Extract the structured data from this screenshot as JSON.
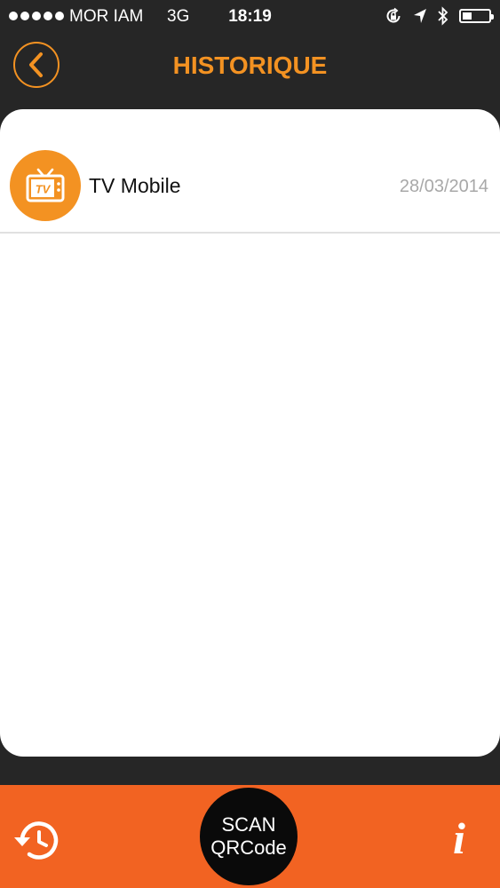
{
  "status_bar": {
    "carrier": "MOR IAM",
    "network": "3G",
    "time": "18:19",
    "battery_level": 0.35,
    "icons": [
      "orientation-lock-icon",
      "location-arrow-icon",
      "bluetooth-icon",
      "battery-icon"
    ]
  },
  "header": {
    "title": "HISTORIQUE",
    "back_icon": "chevron-left-icon"
  },
  "history": {
    "items": [
      {
        "icon": "tv-icon",
        "icon_text": "TV",
        "label": "TV Mobile",
        "date": "28/03/2014"
      }
    ]
  },
  "tabbar": {
    "history_icon": "history-clock-icon",
    "scan_line1": "SCAN",
    "scan_line2": "QRCode",
    "info_label": "i"
  },
  "colors": {
    "accent": "#f39222",
    "tabbar": "#f26322",
    "background": "#262626",
    "card": "#ffffff",
    "date_text": "#a8a8a8"
  }
}
